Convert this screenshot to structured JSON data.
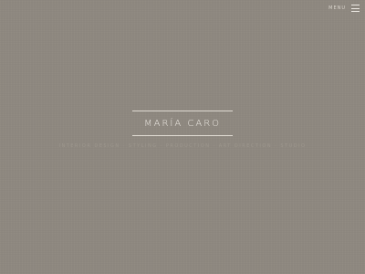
{
  "header": {
    "menu_label": "MENU",
    "menu_icon": "hamburger-icon"
  },
  "brand": {
    "name": "MARÍA CARO",
    "tagline": "INTERIOR DESIGN · STYLING · PRODUCTION · ART DIRECTION · STUDIO"
  },
  "colors": {
    "background": "#8f8980",
    "text_light": "#ece8e2",
    "text_faint": "#9d978e"
  }
}
